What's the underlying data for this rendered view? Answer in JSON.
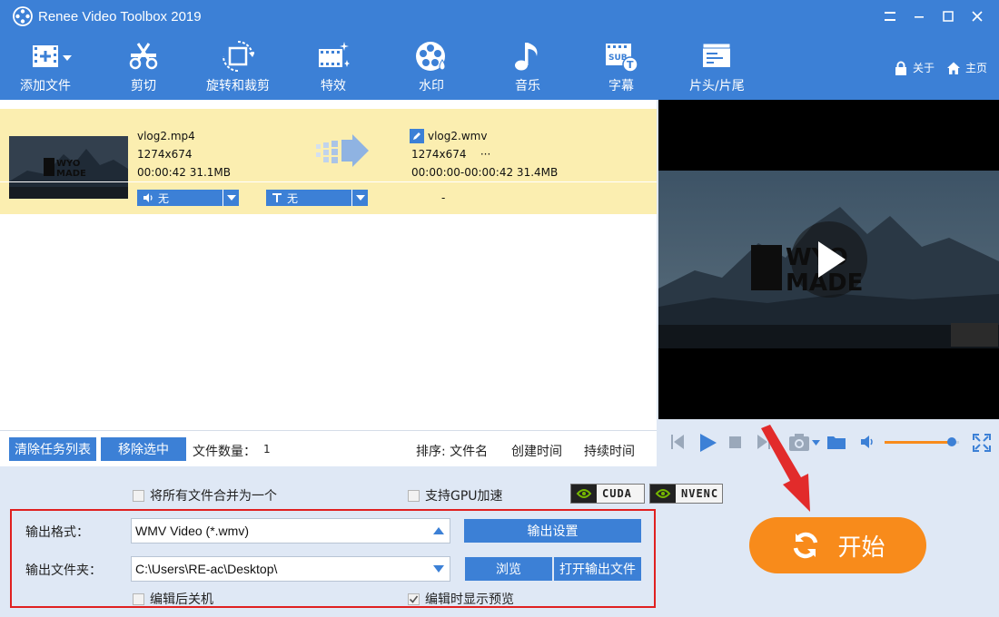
{
  "window": {
    "title": "Renee Video Toolbox 2019"
  },
  "toolbar": {
    "tools": [
      "添加文件",
      "剪切",
      "旋转和裁剪",
      "特效",
      "水印",
      "音乐",
      "字幕",
      "片头/片尾"
    ],
    "about": "关于",
    "home": "主页"
  },
  "file": {
    "src_name": "vlog2.mp4",
    "src_res": "1274x674",
    "src_info": "00:00:42  31.1MB",
    "out_name": "vlog2.wmv",
    "out_res": "1274x674",
    "out_more": "···",
    "out_info": "00:00:00-00:00:42  31.4MB",
    "audio_track": "无",
    "subtitle_track": "无",
    "dash": "-",
    "thumb_text_1": "WYO",
    "thumb_text_2": "MADE"
  },
  "list_footer": {
    "clear_label": "清除任务列表",
    "remove_label": "移除选中",
    "count_label": "文件数量：",
    "count_value": "1",
    "sort_label": "排序: 文件名",
    "sort_created": "创建时间",
    "sort_duration": "持续时间"
  },
  "preview": {
    "logo_line1": "WYO",
    "logo_line2": "MADE",
    "volume": 0.9
  },
  "options": {
    "merge_label": "将所有文件合并为一个",
    "merge_checked": false,
    "gpu_label": "支持GPU加速",
    "gpu_checked": false,
    "cuda": "CUDA",
    "nvenc": "NVENC",
    "shutdown_label": "编辑后关机",
    "shutdown_checked": false,
    "show_preview_label": "编辑时显示预览",
    "show_preview_checked": true
  },
  "output": {
    "format_label": "输出格式：",
    "format_value": "WMV Video (*.wmv)",
    "settings_label": "输出设置",
    "folder_label": "输出文件夹：",
    "folder_value": "C:\\Users\\RE-ac\\Desktop\\",
    "browse_label": "浏览",
    "open_folder_label": "打开输出文件"
  },
  "start": {
    "label": "开始"
  },
  "colors": {
    "primary": "#3c80d6",
    "accent": "#f88b1b",
    "highlight": "#fbeeb0",
    "annotation": "#e02020"
  }
}
